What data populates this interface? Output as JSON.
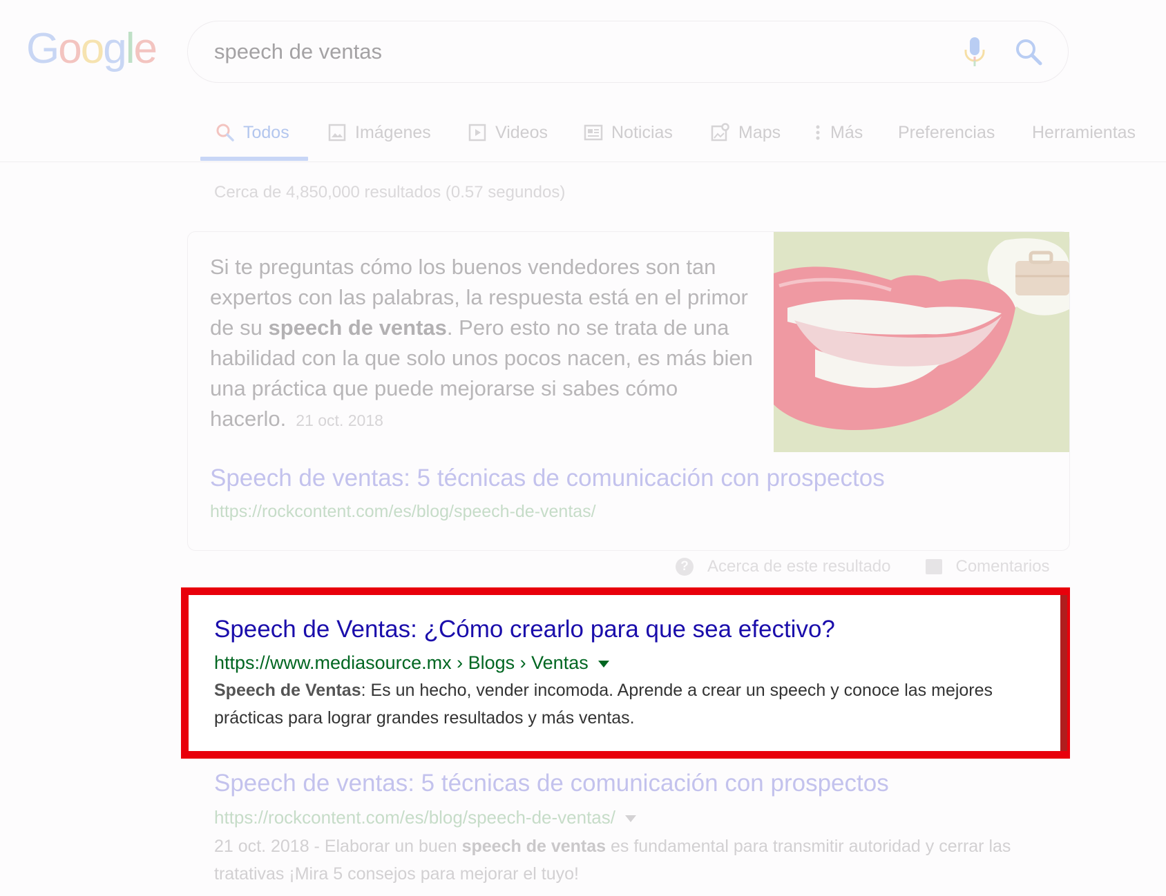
{
  "logo": {
    "letters": [
      "G",
      "o",
      "o",
      "g",
      "l",
      "e"
    ],
    "colors": [
      "#c8d6f4",
      "#f3c4c0",
      "#f6e3b0",
      "#c8d6f4",
      "#bfe0c6",
      "#f3c4c0"
    ]
  },
  "search": {
    "query": "speech de ventas",
    "mic_icon": "microphone-icon",
    "search_icon": "magnifier-icon"
  },
  "tabs": [
    {
      "label": "Todos",
      "icon": "search-icon",
      "active": true
    },
    {
      "label": "Imágenes",
      "icon": "image-icon"
    },
    {
      "label": "Videos",
      "icon": "video-icon"
    },
    {
      "label": "Noticias",
      "icon": "news-icon"
    },
    {
      "label": "Maps",
      "icon": "map-icon"
    },
    {
      "label": "Más",
      "icon": "more-vert-icon"
    },
    {
      "label": "Preferencias"
    },
    {
      "label": "Herramientas"
    }
  ],
  "stats": "Cerca de 4,850,000 resultados (0.57 segundos)",
  "featured": {
    "text_before": "Si te preguntas cómo los buenos vendedores son tan expertos con las palabras, la respuesta está en el primor de su ",
    "text_bold": "speech de ventas",
    "text_after": ". Pero esto no se trata de una habilidad con la que solo unos pocos nacen, es más bien una práctica que puede mejorarse si sabes cómo hacerlo.",
    "date": "21 oct. 2018",
    "title": "Speech de ventas: 5 técnicas de comunicación con prospectos",
    "url": "https://rockcontent.com/es/blog/speech-de-ventas/",
    "image_icon": "lips-speech-bubble-image"
  },
  "about": {
    "about_label": "Acerca de este resultado",
    "feedback_label": "Comentarios"
  },
  "result_highlighted": {
    "title": "Speech de Ventas: ¿Cómo crearlo para que sea efectivo?",
    "url": "https://www.mediasource.mx › Blogs › Ventas",
    "desc_bold": "Speech de Ventas",
    "desc_rest": ": Es un hecho, vender incomoda. Aprende a crear un speech y conoce las mejores prácticas para lograr grandes resultados y más ventas.",
    "highlight_color": "#e8000b"
  },
  "result_next": {
    "title": "Speech de ventas: 5 técnicas de comunicación con prospectos",
    "url": "https://rockcontent.com/es/blog/speech-de-ventas/",
    "desc_date": "21 oct. 2018 - ",
    "desc_pre": "Elaborar un buen ",
    "desc_bold": "speech de ventas",
    "desc_post": " es fundamental para transmitir autoridad y cerrar las tratativas ¡Mira 5 consejos para mejorar el tuyo!"
  }
}
